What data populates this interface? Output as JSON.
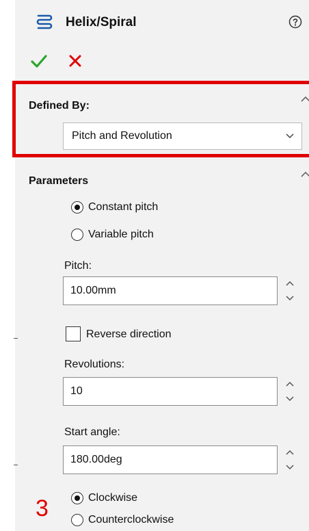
{
  "header": {
    "title": "Helix/Spiral",
    "icons": {
      "feature": "helix-icon",
      "help": "help-icon",
      "ok": "checkmark-icon",
      "cancel": "close-icon"
    },
    "colors": {
      "ok": "#2da42d",
      "cancel": "#e00000"
    }
  },
  "defined_by": {
    "header": "Defined By:",
    "selected": "Pitch and Revolution"
  },
  "parameters": {
    "header": "Parameters",
    "pitch_type_options": [
      {
        "label": "Constant pitch",
        "selected": true
      },
      {
        "label": "Variable pitch",
        "selected": false
      }
    ],
    "pitch": {
      "label": "Pitch:",
      "value": "10.00mm"
    },
    "reverse_direction": {
      "label": "Reverse direction",
      "checked": false
    },
    "revolutions": {
      "label": "Revolutions:",
      "value": "10"
    },
    "start_angle": {
      "label": "Start angle:",
      "value": "180.00deg"
    },
    "direction_options": [
      {
        "label": "Clockwise",
        "selected": true
      },
      {
        "label": "Counterclockwise",
        "selected": false
      }
    ]
  },
  "annotation": {
    "step_number": "3",
    "highlight_color": "#e00000"
  }
}
